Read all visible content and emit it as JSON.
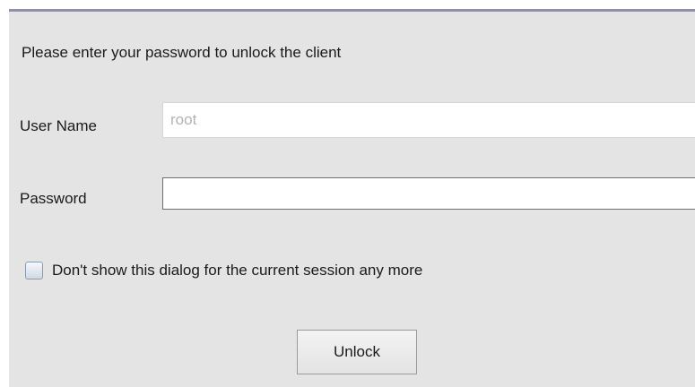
{
  "dialog": {
    "prompt": "Please enter your password to unlock the client",
    "username": {
      "label": "User Name",
      "value": "root"
    },
    "password": {
      "label": "Password",
      "value": ""
    },
    "dont_show_checkbox": {
      "label": "Don't show this dialog for the current session any more",
      "checked": false
    },
    "unlock_button": {
      "label": "Unlock"
    }
  },
  "colors": {
    "dialog_background": "#e4e4e4",
    "dialog_top_border": "#8f8fa6",
    "placeholder_text": "#b3b3b3"
  }
}
